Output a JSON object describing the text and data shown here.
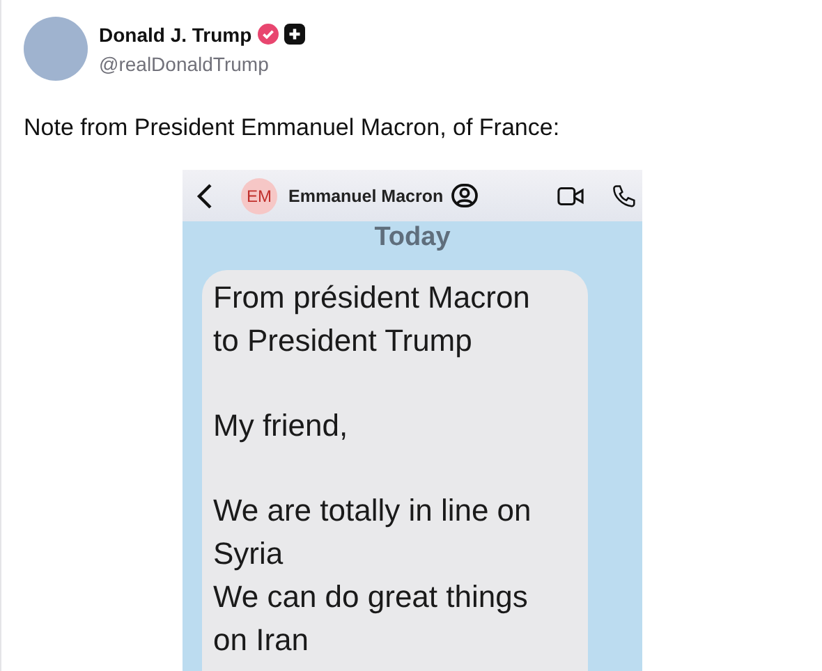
{
  "post": {
    "author": {
      "name": "Donald J. Trump",
      "handle": "@realDonaldTrump",
      "verified": true
    },
    "text": "Note from President Emmanuel Macron, of France:",
    "image": {
      "contact_initials": "EM",
      "contact_name": "Emmanuel Macron",
      "day": "Today",
      "message": [
        [
          "From président Macron",
          "to President Trump"
        ],
        [
          "My friend,"
        ],
        [
          "We are totally in line on",
          "Syria",
          "We can do great things",
          "on Iran"
        ]
      ]
    }
  }
}
